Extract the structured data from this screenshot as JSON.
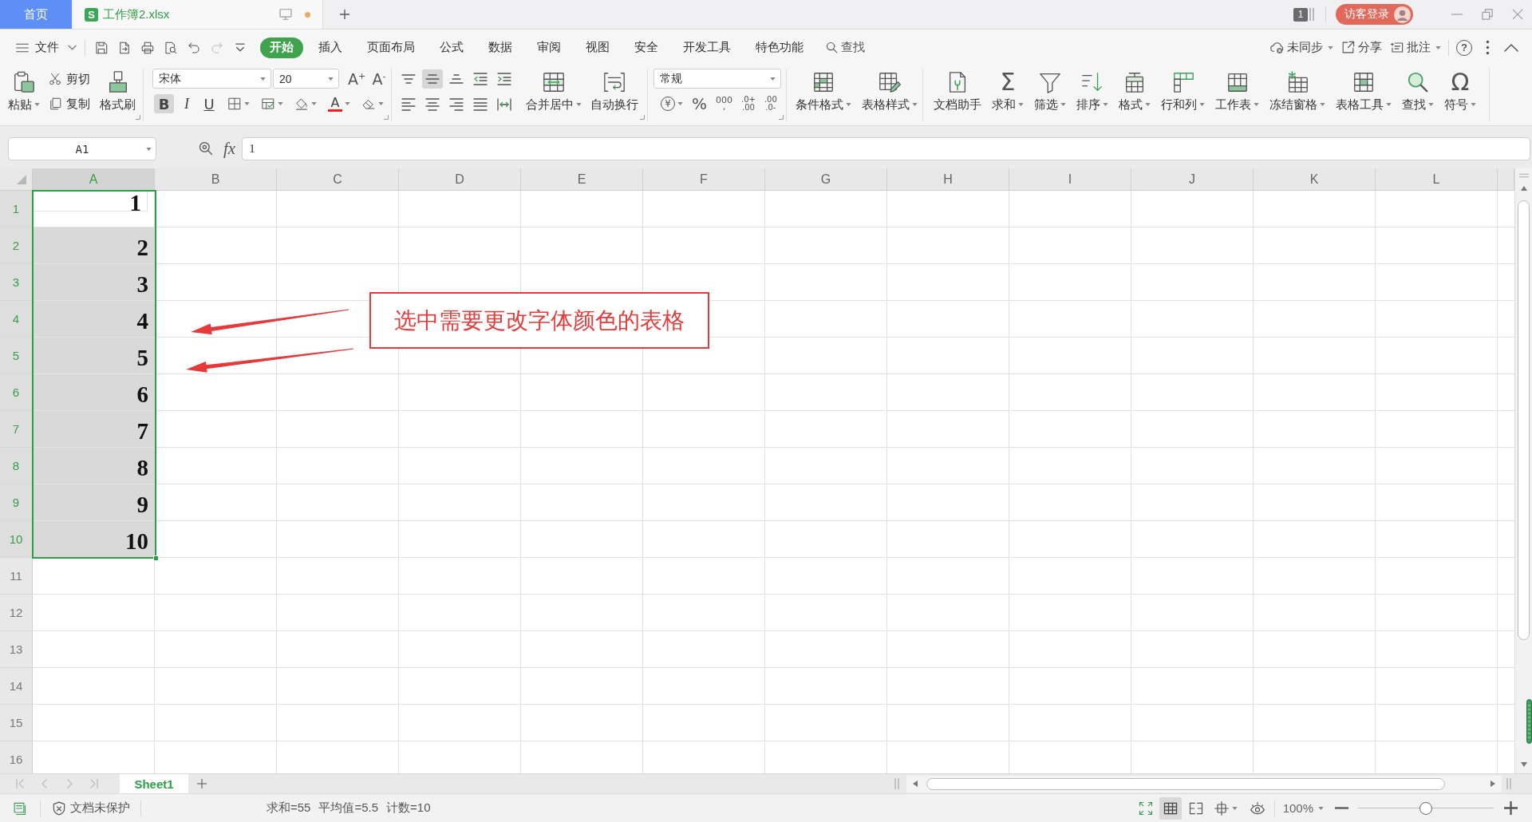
{
  "tabs": [
    {
      "kind": "home",
      "label": "首页",
      "selected": false
    },
    {
      "kind": "document",
      "label": "工作簿2.xlsx",
      "logo": "S",
      "modified": true,
      "selected": true
    }
  ],
  "title_bar": {
    "page_badge": "1",
    "login": "访客登录"
  },
  "menu": {
    "file": "文件",
    "quick_access": [
      {
        "kind": "save",
        "disabled": false
      },
      {
        "kind": "export_pdf",
        "disabled": false
      },
      {
        "kind": "print",
        "disabled": false
      },
      {
        "kind": "print_preview",
        "disabled": false
      },
      {
        "kind": "undo",
        "disabled": false
      },
      {
        "kind": "redo",
        "disabled": true
      },
      {
        "kind": "customize",
        "disabled": false
      }
    ],
    "tabs": [
      {
        "label": "开始",
        "selected": true
      },
      {
        "label": "插入",
        "selected": false
      },
      {
        "label": "页面布局",
        "selected": false
      },
      {
        "label": "公式",
        "selected": false
      },
      {
        "label": "数据",
        "selected": false
      },
      {
        "label": "审阅",
        "selected": false
      },
      {
        "label": "视图",
        "selected": false
      },
      {
        "label": "安全",
        "selected": false
      },
      {
        "label": "开发工具",
        "selected": false
      },
      {
        "label": "特色功能",
        "selected": false
      }
    ],
    "search": "查找",
    "actions": [
      {
        "kind": "sync",
        "label": "未同步",
        "dropdown": true
      },
      {
        "kind": "share",
        "label": "分享",
        "dropdown": false
      },
      {
        "kind": "comment",
        "label": "批注",
        "dropdown": true
      }
    ],
    "help": "?"
  },
  "toolbar": {
    "clipboard": {
      "paste": {
        "label": "粘贴",
        "dropdown": true
      },
      "cut": "剪切",
      "copy": "复制",
      "format_painter": "格式刷"
    },
    "font": {
      "family": "宋体",
      "size": "20",
      "size_buttons": [
        "A$^{+}$",
        "A$^{-}$"
      ],
      "styles": [
        {
          "kind": "bold",
          "glyph": "B",
          "on": true
        },
        {
          "kind": "italic",
          "glyph": "I",
          "on": false
        },
        {
          "kind": "underline",
          "glyph": "U",
          "on": false
        }
      ],
      "tools": [
        {
          "kind": "border",
          "dropdown": true
        },
        {
          "kind": "cell_style",
          "dropdown": true
        },
        {
          "kind": "fill_color",
          "dropdown": true
        },
        {
          "kind": "font_color",
          "glyph": "A",
          "dropdown": true
        },
        {
          "kind": "clear",
          "dropdown": true
        }
      ]
    },
    "alignment": {
      "top_row": [
        {
          "kind": "align_top",
          "on": false
        },
        {
          "kind": "align_middle",
          "on": true
        },
        {
          "kind": "align_bottom",
          "on": false
        },
        {
          "kind": "decrease_indent",
          "on": false
        },
        {
          "kind": "increase_indent",
          "on": false
        }
      ],
      "bottom_row": [
        {
          "kind": "align_left",
          "on": false
        },
        {
          "kind": "align_center",
          "on": false
        },
        {
          "kind": "align_right",
          "on": false
        },
        {
          "kind": "justify",
          "on": false
        },
        {
          "kind": "distribute",
          "on": false
        }
      ],
      "buttons": [
        {
          "kind": "merge_center",
          "label": "合并居中",
          "dropdown": true
        },
        {
          "kind": "wrap_text",
          "label": "自动换行",
          "dropdown": false
        }
      ]
    },
    "number": {
      "format": "常规",
      "buttons": [
        {
          "kind": "currency",
          "lines": [
            "¥"
          ],
          "dropdown": true
        },
        {
          "kind": "percent",
          "lines": [
            "%"
          ],
          "dropdown": false
        },
        {
          "kind": "thousands",
          "lines": [
            "000",
            ","
          ],
          "dropdown": false
        },
        {
          "kind": "add_decimal",
          "lines": [
            ".0+",
            ".00"
          ],
          "dropdown": false
        },
        {
          "kind": "remove_decimal",
          "lines": [
            ".00",
            ".0-"
          ],
          "dropdown": false
        }
      ]
    },
    "styles": [
      {
        "kind": "conditional_format",
        "label": "条件格式",
        "dropdown": true
      },
      {
        "kind": "table_style",
        "label": "表格样式",
        "dropdown": true
      }
    ],
    "tools": [
      {
        "kind": "doc_assistant",
        "label": "文档助手",
        "dropdown": false
      },
      {
        "kind": "sum",
        "glyph": "Σ",
        "label": "求和",
        "dropdown": true
      },
      {
        "kind": "filter",
        "label": "筛选",
        "dropdown": true
      },
      {
        "kind": "sort",
        "label": "排序",
        "dropdown": true
      },
      {
        "kind": "format",
        "label": "格式",
        "dropdown": true
      },
      {
        "kind": "rows_columns",
        "label": "行和列",
        "dropdown": true
      },
      {
        "kind": "worksheet",
        "label": "工作表",
        "dropdown": true
      },
      {
        "kind": "freeze_panes",
        "label": "冻结窗格",
        "dropdown": true
      },
      {
        "kind": "table_tools",
        "label": "表格工具",
        "dropdown": true
      },
      {
        "kind": "find",
        "label": "查找",
        "dropdown": true
      },
      {
        "kind": "symbol",
        "glyph": "Ω",
        "label": "符号",
        "dropdown": true
      }
    ]
  },
  "formula_bar": {
    "name_box": "A1",
    "fx": "fx",
    "value": "1"
  },
  "sheet": {
    "columns": [
      {
        "label": "A",
        "selected": true
      },
      {
        "label": "B",
        "selected": false
      },
      {
        "label": "C",
        "selected": false
      },
      {
        "label": "D",
        "selected": false
      },
      {
        "label": "E",
        "selected": false
      },
      {
        "label": "F",
        "selected": false
      },
      {
        "label": "G",
        "selected": false
      },
      {
        "label": "H",
        "selected": false
      },
      {
        "label": "I",
        "selected": false
      },
      {
        "label": "J",
        "selected": false
      },
      {
        "label": "K",
        "selected": false
      },
      {
        "label": "L",
        "selected": false
      }
    ],
    "rows": [
      {
        "label": "1",
        "selected": true,
        "active": true,
        "value": "1"
      },
      {
        "label": "2",
        "selected": true,
        "active": false,
        "value": "2"
      },
      {
        "label": "3",
        "selected": true,
        "active": false,
        "value": "3"
      },
      {
        "label": "4",
        "selected": true,
        "active": false,
        "value": "4"
      },
      {
        "label": "5",
        "selected": true,
        "active": false,
        "value": "5"
      },
      {
        "label": "6",
        "selected": true,
        "active": false,
        "value": "6"
      },
      {
        "label": "7",
        "selected": true,
        "active": false,
        "value": "7"
      },
      {
        "label": "8",
        "selected": true,
        "active": false,
        "value": "8"
      },
      {
        "label": "9",
        "selected": true,
        "active": false,
        "value": "9"
      },
      {
        "label": "10",
        "selected": true,
        "active": false,
        "value": "10"
      },
      {
        "label": "11",
        "selected": false,
        "active": false
      },
      {
        "label": "12",
        "selected": false,
        "active": false
      },
      {
        "label": "13",
        "selected": false,
        "active": false
      },
      {
        "label": "14",
        "selected": false,
        "active": false
      },
      {
        "label": "15",
        "selected": false,
        "active": false
      },
      {
        "label": "16",
        "selected": false,
        "active": false
      }
    ]
  },
  "annotation": {
    "text": "选中需要更改字体颜色的表格"
  },
  "sheet_tabs": [
    {
      "label": "Sheet1",
      "selected": true
    }
  ],
  "status_bar": {
    "protection": "文档未保护",
    "stats": [
      "求和=55",
      "平均值=5.5",
      "计数=10"
    ],
    "views": [
      {
        "kind": "normal_view",
        "selected": true,
        "dropdown": false
      },
      {
        "kind": "page_break_view",
        "selected": false,
        "dropdown": false
      },
      {
        "kind": "reading_view",
        "selected": false,
        "dropdown": true
      }
    ],
    "zoom": {
      "reading": "100%",
      "level": 0.5
    }
  }
}
